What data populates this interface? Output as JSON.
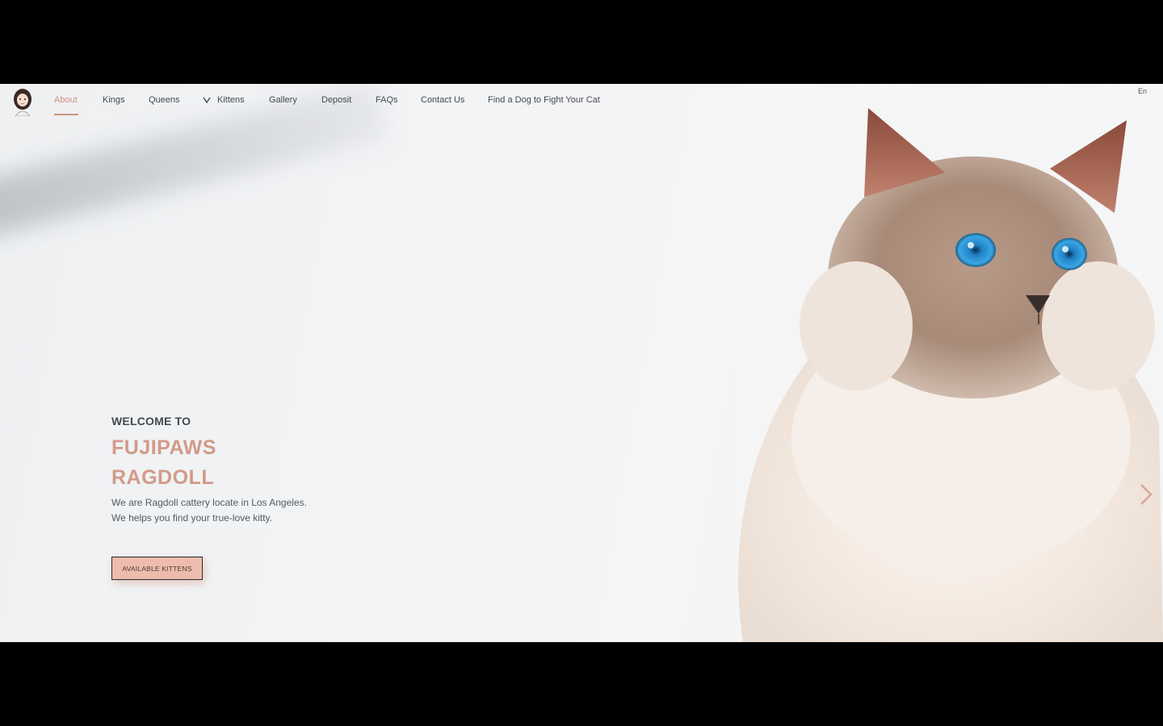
{
  "nav": {
    "items": [
      {
        "label": "About"
      },
      {
        "label": "Kings"
      },
      {
        "label": "Queens"
      },
      {
        "label": "Kittens"
      },
      {
        "label": "Gallery"
      },
      {
        "label": "Deposit"
      },
      {
        "label": "FAQs"
      },
      {
        "label": "Contact Us"
      },
      {
        "label": "Find a Dog to Fight Your Cat"
      }
    ],
    "active_index": 0,
    "language": "En"
  },
  "hero": {
    "welcome": "WELCOME TO",
    "brand_line1": "FUJIPAWS",
    "brand_line2": "RAGDOLL",
    "desc_line1": "We are Ragdoll cattery locate in Los Angeles.",
    "desc_line2": "We helps you find your true-love kitty.",
    "cta_label": "AVAILABLE KITTENS"
  },
  "colors": {
    "accent": "#d0917f",
    "cta_bg": "#edbcae",
    "text_dark": "#454a4e"
  },
  "icons": {
    "logo": "girl-avatar-logo",
    "dropdown": "chevron-down-icon",
    "next": "chevron-right-icon"
  }
}
